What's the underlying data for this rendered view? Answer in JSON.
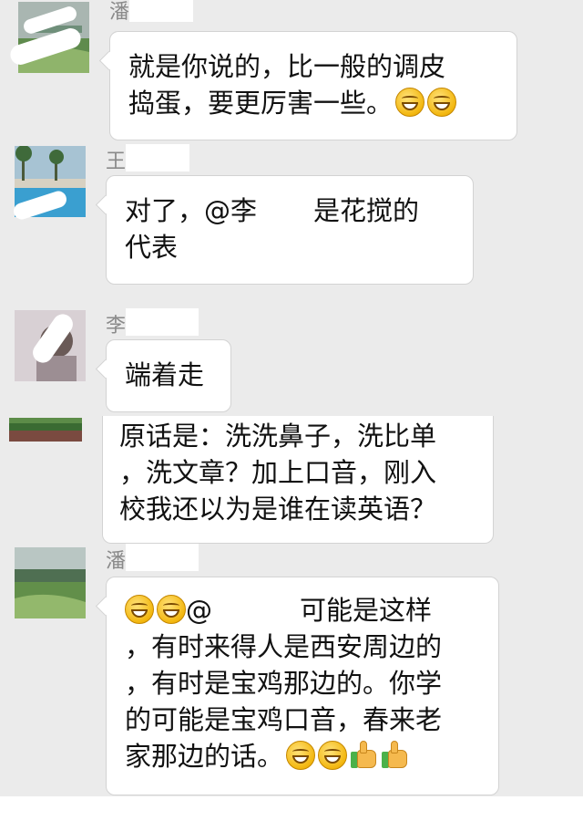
{
  "messages": [
    {
      "sender_visible": "潘",
      "lines": [
        "就是你说的，比一般的调皮",
        "捣蛋，要更厉害一些。"
      ],
      "trailing_emoji": [
        "grin-emoji",
        "grin-emoji"
      ]
    },
    {
      "sender_visible": "王",
      "line1_pre": "对了，@李",
      "line1_post": "是花搅的",
      "line2": "代表"
    },
    {
      "sender_visible": "李",
      "lines": [
        "端着走"
      ]
    },
    {
      "lines": [
        "原话是：洗洗鼻子，洗比单",
        "，洗文章？加上口音，刚入",
        "校我还以为是谁在读英语？"
      ]
    },
    {
      "sender_visible": "潘",
      "line1_pre": "@",
      "line1_post": "可能是这样",
      "lines_rest": [
        "，有时来得人是西安周边的",
        "，有时是宝鸡那边的。你学",
        "的可能是宝鸡口音，春来老"
      ],
      "last_line": "家那边的话。",
      "trailing_emoji": [
        "grin-emoji",
        "grin-emoji",
        "thumbs-up-icon",
        "thumbs-up-icon"
      ]
    }
  ],
  "colors": {
    "background": "#ebebeb",
    "bubble": "#ffffff",
    "sender_name": "#8a8a8a",
    "text": "#111111"
  }
}
